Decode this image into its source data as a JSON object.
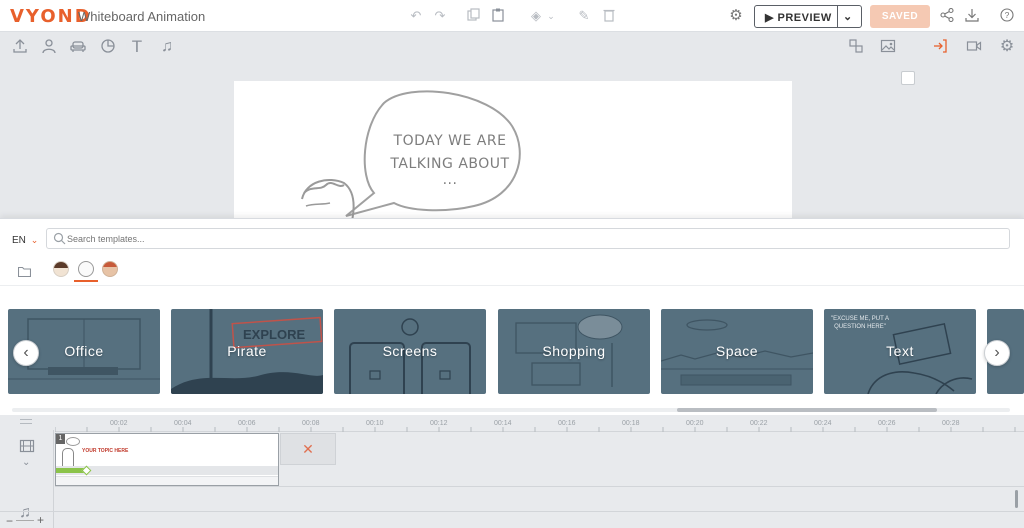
{
  "app": {
    "logo": "VYOND",
    "logo_color": "#e8602c",
    "title": "Whiteboard Animation"
  },
  "topbar": {
    "preview_label": "▶ PREVIEW",
    "saved_label": "SAVED",
    "saved_color": "#f5c9b3"
  },
  "icons": {
    "top": [
      "undo-icon",
      "redo-icon",
      "copy-icon",
      "paste-icon",
      "layers-icon",
      "brush-icon",
      "trash-icon",
      "settings-icon",
      "share-icon",
      "download-icon",
      "help-icon"
    ],
    "toolbar": [
      "upload-icon",
      "person-icon",
      "furniture-icon",
      "chart-icon",
      "text-icon",
      "music-icon",
      "swap-icon",
      "image-icon",
      "color-swatch-icon",
      "enter-icon",
      "video-icon",
      "gear-icon"
    ]
  },
  "stage": {
    "bubble_line1": "TODAY WE ARE",
    "bubble_line2": "TALKING ABOUT ..."
  },
  "panel": {
    "language": "EN",
    "search_placeholder": "Search templates...",
    "categories": [
      {
        "label": "Office"
      },
      {
        "label": "Pirate"
      },
      {
        "label": "Screens"
      },
      {
        "label": "Shopping"
      },
      {
        "label": "Space"
      },
      {
        "label": "Text"
      }
    ],
    "text_card_note": "\"EXCUSE ME, PUT A QUESTION HERE\""
  },
  "timeline": {
    "ticks": [
      "00:02",
      "00:04",
      "00:06",
      "00:08",
      "00:10",
      "00:12",
      "00:14",
      "00:16",
      "00:18",
      "00:20",
      "00:22",
      "00:24",
      "00:26",
      "00:28"
    ],
    "scene_number": "1",
    "scene_thumb_title": "YOUR TOPIC HERE",
    "delete_label": "✕",
    "zoom_out": "−",
    "zoom_in": "+"
  }
}
